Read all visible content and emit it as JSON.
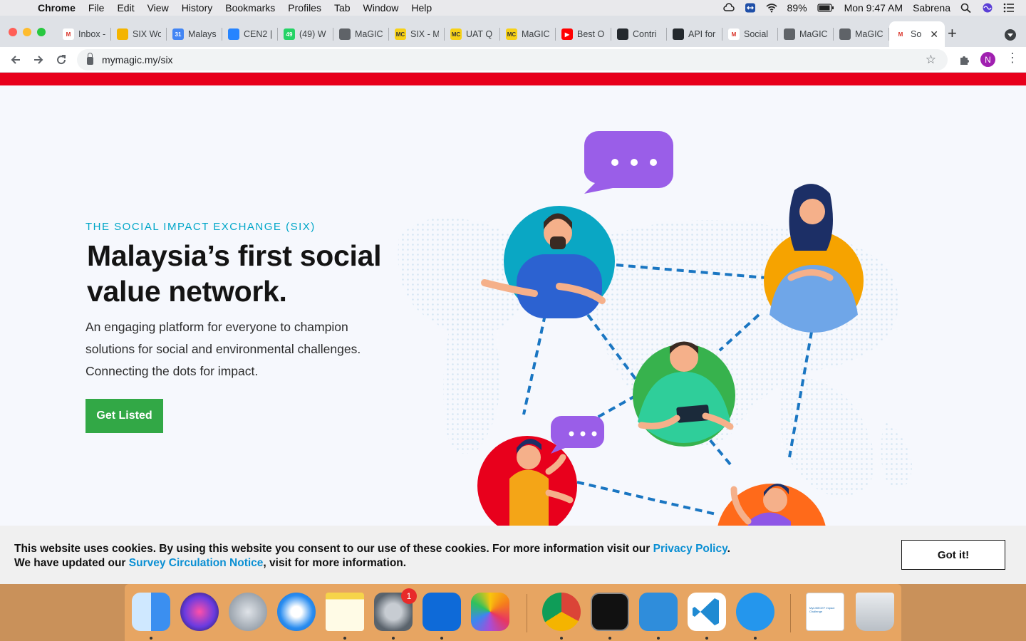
{
  "menubar": {
    "app": "Chrome",
    "items": [
      "File",
      "Edit",
      "View",
      "History",
      "Bookmarks",
      "Profiles",
      "Tab",
      "Window",
      "Help"
    ],
    "battery": "89%",
    "clock": "Mon 9:47 AM",
    "user": "Sabrena"
  },
  "tabs": [
    {
      "label": "Inbox -",
      "fav_color": "#ffffff",
      "fav_text": "M"
    },
    {
      "label": "SIX Wo",
      "fav_color": "#f4b400",
      "fav_text": ""
    },
    {
      "label": "Malays",
      "fav_color": "#4285f4",
      "fav_text": "31"
    },
    {
      "label": "CEN2 |",
      "fav_color": "#2684ff",
      "fav_text": ""
    },
    {
      "label": "(49) W",
      "fav_color": "#25d366",
      "fav_text": "49"
    },
    {
      "label": "MaGIC",
      "fav_color": "#5f6368",
      "fav_text": ""
    },
    {
      "label": "SIX - M",
      "fav_color": "#f7d117",
      "fav_text": "MC"
    },
    {
      "label": "UAT Q",
      "fav_color": "#f7d117",
      "fav_text": "MC"
    },
    {
      "label": "MaGIC",
      "fav_color": "#f7d117",
      "fav_text": "MC"
    },
    {
      "label": "Best O",
      "fav_color": "#ff0000",
      "fav_text": "▶"
    },
    {
      "label": "Contri",
      "fav_color": "#24292e",
      "fav_text": ""
    },
    {
      "label": "API for",
      "fav_color": "#24292e",
      "fav_text": ""
    },
    {
      "label": "Social",
      "fav_color": "#ffffff",
      "fav_text": "M"
    },
    {
      "label": "MaGIC",
      "fav_color": "#5f6368",
      "fav_text": ""
    },
    {
      "label": "MaGIC",
      "fav_color": "#5f6368",
      "fav_text": ""
    },
    {
      "label": "So",
      "fav_color": "#ffffff",
      "fav_text": "M",
      "active": true
    }
  ],
  "address": {
    "url": "mymagic.my/six",
    "profile_initial": "N"
  },
  "hero": {
    "eyebrow": "THE SOCIAL IMPACT EXCHANGE (SIX)",
    "headline": "Malaysia’s first social value network.",
    "lead": "An engaging platform for everyone to champion solutions for social and environmental challenges. Connecting the dots for impact.",
    "cta": "Get Listed"
  },
  "cookie": {
    "line1_pre": "This website uses cookies. By using this website you consent to our use of these cookies. For more information visit our ",
    "line1_link": "Privacy Policy",
    "line1_post": ".",
    "line2_pre": "We have updated our ",
    "line2_link": "Survey Circulation Notice",
    "line2_post": ", visit for more information.",
    "button": "Got it!"
  },
  "dock": {
    "apps": [
      "finder",
      "siri",
      "launchpad",
      "safari",
      "notes",
      "system-preferences",
      "teamviewer",
      "photos",
      "chrome",
      "terminal",
      "fork",
      "vscode",
      "docker",
      "document-preview",
      "trash"
    ],
    "system_preferences_badge": "1",
    "preview_title": "MyLINECEF Impact Challenge"
  },
  "colors": {
    "brand_red": "#e8001c",
    "accent_teal": "#00a6c8",
    "cta_green": "#32a846",
    "link_blue": "#0a8fd3"
  }
}
